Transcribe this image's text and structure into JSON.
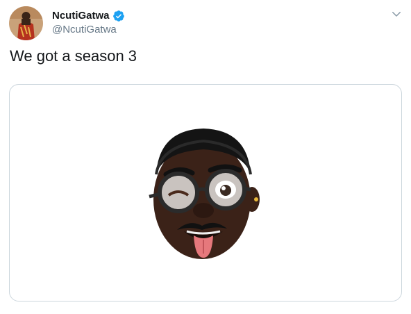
{
  "tweet": {
    "author": {
      "display_name": "NcutiGatwa",
      "handle": "@NcutiGatwa",
      "verified": true,
      "verified_color": "#1da1f2"
    },
    "text": "We got a season 3",
    "media": {
      "type": "image",
      "subject": "memoji-face-tongue-out-glasses"
    },
    "menu_icon": "chevron-down-icon"
  },
  "colors": {
    "text_primary": "#14171a",
    "text_secondary": "#657786",
    "border": "#ccd6dd"
  }
}
